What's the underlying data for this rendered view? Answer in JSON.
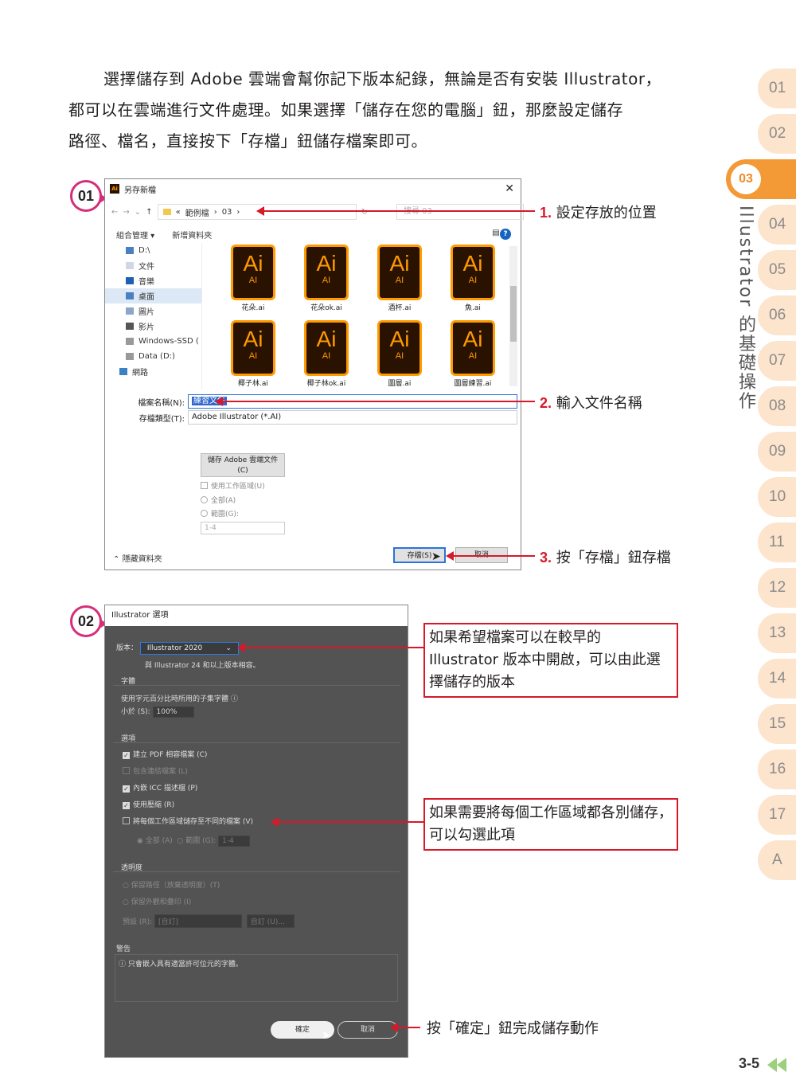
{
  "intro": {
    "line1": "選擇儲存到 Adobe 雲端會幫你記下版本紀錄，無論是否有安裝 Illustrator，",
    "line2": "都可以在雲端進行文件處理。如果選擇「儲存在您的電腦」鈕，那麼設定儲存",
    "line3": "路徑、檔名，直接按下「存檔」鈕儲存檔案即可。"
  },
  "side_tabs": [
    "01",
    "02",
    "03",
    "04",
    "05",
    "06",
    "07",
    "08",
    "09",
    "10",
    "11",
    "12",
    "13",
    "14",
    "15",
    "16",
    "17",
    "A"
  ],
  "active_tab": "03",
  "chapter_title": "Illustrator 的基礎操作",
  "step1": {
    "badge": "01",
    "dialog": {
      "title": "另存新檔",
      "path_prefix": "«",
      "path_folder": "範例檔",
      "path_sub": "03",
      "search_placeholder": "搜尋 03",
      "toolbar_organize": "組合管理 ▾",
      "toolbar_newfolder": "新增資料夾",
      "nav_items": [
        "D:\\",
        "文件",
        "音樂",
        "桌面",
        "圖片",
        "影片",
        "Windows-SSD (",
        "Data (D:)",
        "網路"
      ],
      "files": [
        {
          "label": "Ai",
          "sub": "AI",
          "name": "花朵.ai"
        },
        {
          "label": "Ai",
          "sub": "AI",
          "name": "花朵ok.ai"
        },
        {
          "label": "Ai",
          "sub": "AI",
          "name": "酒杯.ai"
        },
        {
          "label": "Ai",
          "sub": "AI",
          "name": "魚.ai"
        },
        {
          "label": "Ai",
          "sub": "AI",
          "name": "椰子林.ai"
        },
        {
          "label": "Ai",
          "sub": "AI",
          "name": "椰子林ok.ai"
        },
        {
          "label": "Ai",
          "sub": "AI",
          "name": "圖層.ai"
        },
        {
          "label": "Ai",
          "sub": "AI",
          "name": "圖層練習.ai"
        }
      ],
      "filename_label": "檔案名稱(N):",
      "filename_value": "練習文件",
      "filetype_label": "存檔類型(T):",
      "filetype_value": "Adobe Illustrator (*.AI)",
      "cloud_button_line1": "儲存 Adobe 雲端文件",
      "cloud_button_line2": "(C)",
      "use_artboards": "使用工作區域(U)",
      "all": "全部(A)",
      "range": "範圍(G):",
      "range_value": "1-4",
      "hide_folders": "隱藏資料夾",
      "save_button": "存檔(S)",
      "cancel_button": "取消"
    },
    "callouts": [
      {
        "num": "1.",
        "text": "設定存放的位置"
      },
      {
        "num": "2.",
        "text": "輸入文件名稱"
      },
      {
        "num": "3.",
        "text": "按「存檔」鈕存檔"
      }
    ]
  },
  "step2": {
    "badge": "02",
    "dialog": {
      "title": "Illustrator 選項",
      "version_label": "版本：",
      "version_value": "Illustrator 2020",
      "compat_note": "與 Illustrator 24 和以上版本相容。",
      "fonts_header": "字體",
      "subset_text": "使用字元百分比時所用的子集字體",
      "subset_label": "小於 (S):",
      "subset_value": "100%",
      "options_header": "選項",
      "opt_pdf": "建立 PDF 相容檔案 (C)",
      "opt_linked": "包含連結檔案 (L)",
      "opt_icc": "內嵌 ICC 描述檔 (P)",
      "opt_compress": "使用壓縮 (R)",
      "opt_artboards": "將每個工作區域儲存至不同的檔案 (V)",
      "opt_all": "全部 (A)",
      "opt_range": "範圍 (G):",
      "opt_range_value": "1-4",
      "transparency_header": "透明度",
      "trans_keep": "保留路徑（放棄透明度）(T)",
      "trans_preserve": "保留外觀和疊印 (I)",
      "preset_label": "預設 (R):",
      "preset_value": "[自訂]",
      "custom_button": "自訂 (U)...",
      "warning_header": "警告",
      "warning_text": "只會嵌入具有適當許可位元的字體。",
      "ok_button": "確定",
      "cancel_button": "取消"
    },
    "note1": "如果希望檔案可以在較早的 Illustrator 版本中開啟，可以由此選擇儲存的版本",
    "note2": "如果需要將每個工作區域都各別儲存，可以勾選此項",
    "callout_ok": "按「確定」鈕完成儲存動作"
  },
  "page_number": "3-5",
  "colors": {
    "accent": "#d7192a",
    "tab_active": "#f39a37",
    "tab": "#fde4cd",
    "badge": "#d62e7b"
  }
}
